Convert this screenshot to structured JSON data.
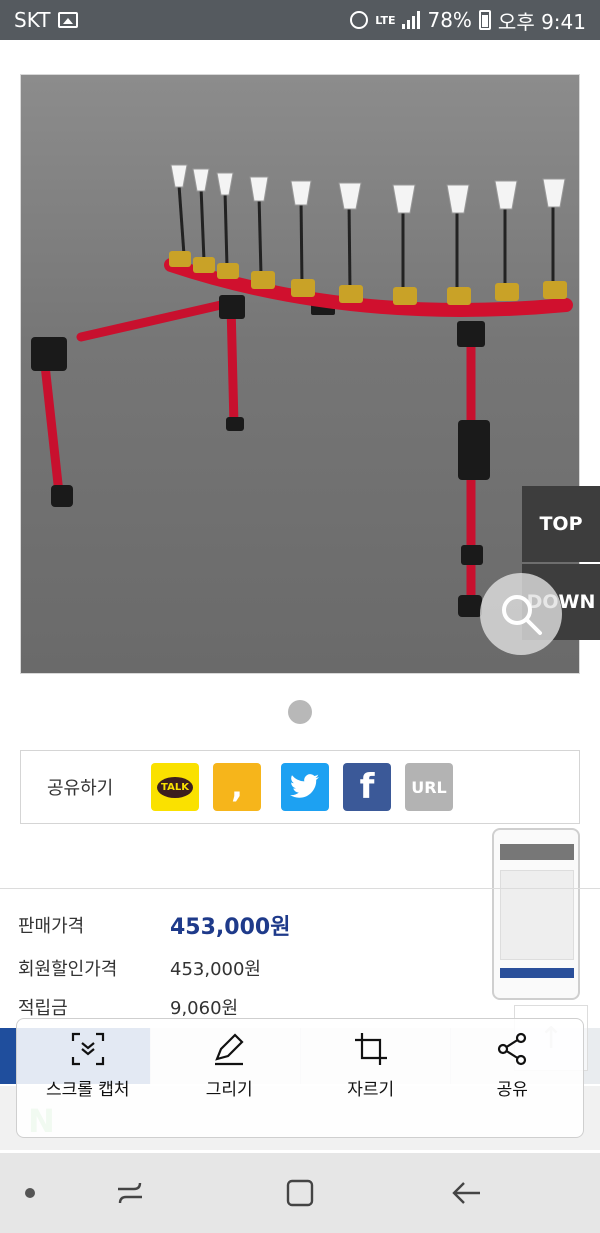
{
  "status_bar": {
    "carrier": "SKT",
    "network": "LTE",
    "battery": "78%",
    "time": "오후 9:41"
  },
  "product": {
    "title_fragment": "……………",
    "image_alt": "fishing rod holder stand"
  },
  "share": {
    "label": "공유하기",
    "buttons": [
      {
        "name": "kakaotalk",
        "text": "TALK"
      },
      {
        "name": "kakaostory",
        "text": ","
      },
      {
        "name": "twitter",
        "text": ""
      },
      {
        "name": "facebook",
        "text": "f"
      },
      {
        "name": "url",
        "text": "URL"
      }
    ]
  },
  "prices": {
    "sale_label": "판매가격",
    "sale_value": "453,000원",
    "member_label": "회원할인가격",
    "member_value": "453,000원",
    "points_label": "적립금",
    "points_value": "9,060원"
  },
  "side_buttons": {
    "top": "TOP",
    "down": "DOWN"
  },
  "capture_menu": {
    "items": [
      {
        "label": "스크롤 캡처",
        "icon": "scroll-capture-icon"
      },
      {
        "label": "그리기",
        "icon": "pen-icon"
      },
      {
        "label": "자르기",
        "icon": "crop-icon"
      },
      {
        "label": "공유",
        "icon": "share-icon"
      }
    ]
  },
  "colors": {
    "status_bar": "#555a5f",
    "price_accent": "#1e3a8a",
    "tab_blue": "#1f4e9d"
  }
}
